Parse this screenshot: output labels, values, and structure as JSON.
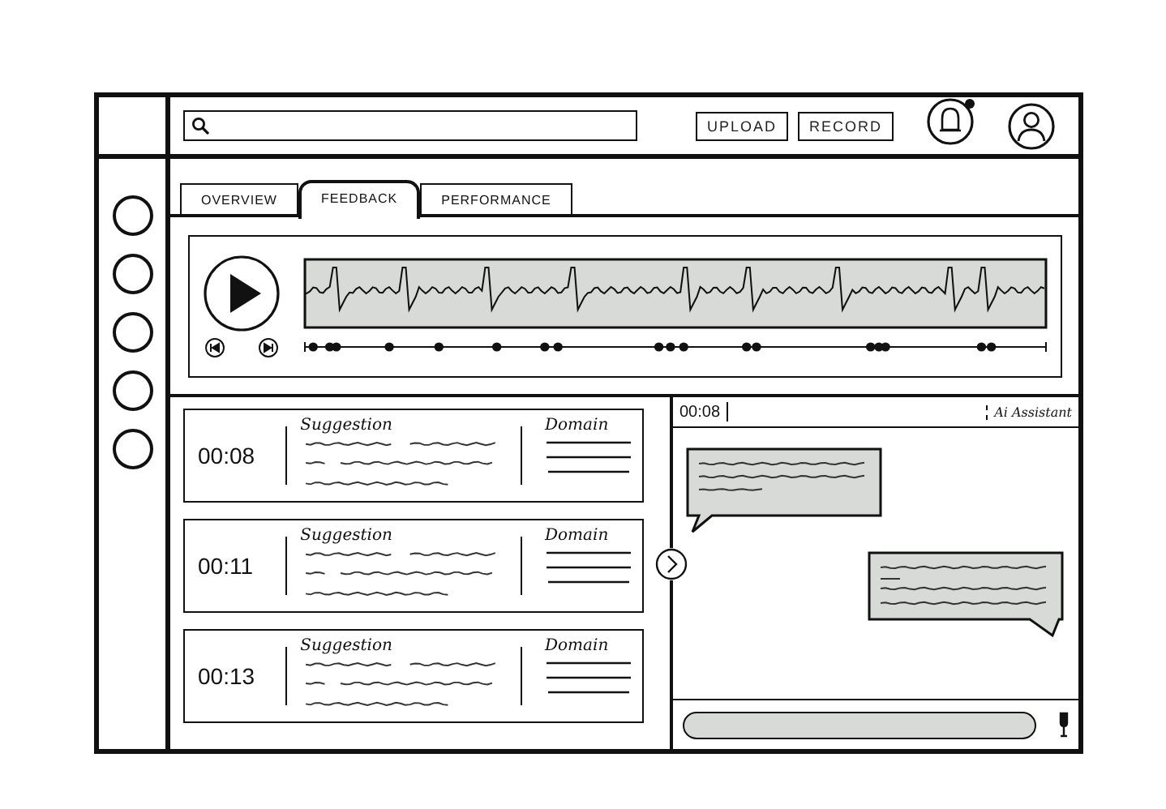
{
  "top_bar": {
    "buttons": [
      "UPLOAD",
      "RECORD"
    ],
    "notification": true
  },
  "tabs": [
    {
      "label": "OVERVIEW",
      "selected": false
    },
    {
      "label": "FEEDBACK",
      "selected": true
    },
    {
      "label": "PERFORMANCE",
      "selected": false
    }
  ],
  "suggestions": [
    {
      "time": "00:08",
      "title": "Suggestion",
      "domain": "Domain"
    },
    {
      "time": "00:11",
      "title": "Suggestion",
      "domain": "Domain"
    },
    {
      "time": "00:13",
      "title": "Suggestion",
      "domain": "Domain"
    }
  ],
  "chat": {
    "time": "00:08",
    "assistant": "Ai Assistant",
    "messages": [
      {
        "kind": "received"
      },
      {
        "kind": "sent"
      }
    ]
  }
}
